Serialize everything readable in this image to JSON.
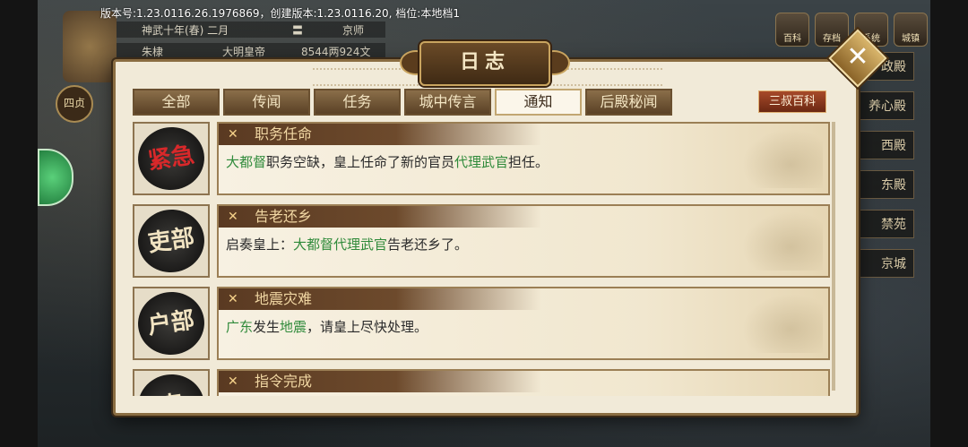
{
  "version_text": "版本号:1.23.0116.26.1976869，创建版本:1.23.0116.20, 档位:本地档1",
  "bg_info": {
    "row1": [
      "神武十年(春) 二月",
      "〓",
      "京师"
    ],
    "row2": [
      "朱棣",
      "大明皇帝",
      "8544两924文"
    ]
  },
  "side_badge": "四贞",
  "top_icons": [
    "百科",
    "存档",
    "系统",
    "城镇"
  ],
  "side_menu": [
    "政殿",
    "养心殿",
    "西殿",
    "东殿",
    "禁苑",
    "京城"
  ],
  "panel": {
    "title": "日志",
    "tabs": [
      "全部",
      "传闻",
      "任务",
      "城中传言",
      "通知",
      "后殿秘闻"
    ],
    "active_tab": "通知",
    "wiki_button": "三叔百科",
    "close_icon": "✕"
  },
  "entries": [
    {
      "seal": "紧急",
      "seal_color": "#d8282a",
      "title": "职务任命",
      "body": [
        {
          "t": "大都督",
          "h": true
        },
        {
          "t": "职务空缺，皇上任命了新的官员",
          "h": false
        },
        {
          "t": "代理武官",
          "h": true
        },
        {
          "t": "担任。",
          "h": false
        }
      ]
    },
    {
      "seal": "吏部",
      "seal_color": "#f2e4c2",
      "title": "告老还乡",
      "body": [
        {
          "t": "启奏皇上：",
          "h": false
        },
        {
          "t": "大都督代理武官",
          "h": true
        },
        {
          "t": "告老还乡了。",
          "h": false
        }
      ]
    },
    {
      "seal": "户部",
      "seal_color": "#f2e4c2",
      "title": "地震灾难",
      "body": [
        {
          "t": "广东",
          "h": true
        },
        {
          "t": "发生",
          "h": false
        },
        {
          "t": "地震",
          "h": true
        },
        {
          "t": "，请皇上尽快处理。",
          "h": false
        }
      ]
    },
    {
      "seal": "吏",
      "seal_color": "#f2e4c2",
      "title": "指令完成",
      "body": []
    }
  ],
  "colors": {
    "highlight": "#2f8a3a",
    "accent": "#8a6d42"
  }
}
